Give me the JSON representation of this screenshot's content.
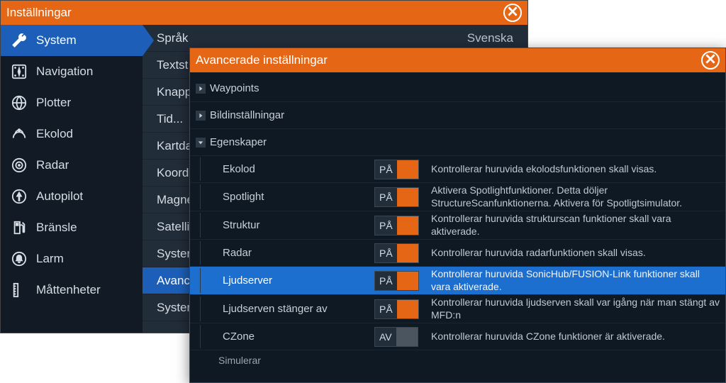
{
  "win1": {
    "title": "Inställningar",
    "sidebar": [
      {
        "id": "system",
        "label": "System",
        "icon": "wrench",
        "selected": true
      },
      {
        "id": "navigation",
        "label": "Navigation",
        "icon": "compass-square"
      },
      {
        "id": "plotter",
        "label": "Plotter",
        "icon": "globe"
      },
      {
        "id": "ekolod",
        "label": "Ekolod",
        "icon": "sonar"
      },
      {
        "id": "radar",
        "label": "Radar",
        "icon": "target"
      },
      {
        "id": "autopilot",
        "label": "Autopilot",
        "icon": "arrow-circle"
      },
      {
        "id": "bransle",
        "label": "Bränsle",
        "icon": "fuel"
      },
      {
        "id": "larm",
        "label": "Larm",
        "icon": "bell"
      },
      {
        "id": "matten",
        "label": "Måttenheter",
        "icon": "ruler"
      }
    ],
    "rows": [
      {
        "label": "Språk",
        "value": "Svenska"
      },
      {
        "label": "Textst"
      },
      {
        "label": "Knapp"
      },
      {
        "label": "Tid..."
      },
      {
        "label": "Kartda"
      },
      {
        "label": "Koord"
      },
      {
        "label": "Magne"
      },
      {
        "label": "Satelli"
      },
      {
        "label": "Syster"
      },
      {
        "label": "Avanc",
        "selected": true
      },
      {
        "label": "Syster"
      }
    ]
  },
  "win2": {
    "title": "Avancerade inställningar",
    "groups": [
      {
        "label": "Waypoints",
        "expanded": false
      },
      {
        "label": "Bildinställningar",
        "expanded": false
      },
      {
        "label": "Egenskaper",
        "expanded": true
      }
    ],
    "features": [
      {
        "label": "Ekolod",
        "state": "PÅ",
        "on": true,
        "desc": "Kontrollerar huruvida ekolodsfunktionen skall visas."
      },
      {
        "label": "Spotlight",
        "state": "PÅ",
        "on": true,
        "desc": "Aktivera Spotlightfunktioner. Detta döljer StructureScanfunktionerna. Aktivera för Spotligtsimulator."
      },
      {
        "label": "Struktur",
        "state": "PÅ",
        "on": true,
        "desc": "Kontrollerar huruvida strukturscan funktioner skall vara aktiverade."
      },
      {
        "label": "Radar",
        "state": "PÅ",
        "on": true,
        "desc": "Kontrollerar huruvida radarfunktionen skall visas."
      },
      {
        "label": "Ljudserver",
        "state": "PÅ",
        "on": true,
        "selected": true,
        "desc": "Kontrollerar huruvida SonicHub/FUSION-Link funktioner skall vara aktiverade."
      },
      {
        "label": "Ljudserven stänger av",
        "state": "PÅ",
        "on": true,
        "desc": "Kontrollerar huruvida ljudserven skall var igång när man stängt av MFD:n"
      },
      {
        "label": "CZone",
        "state": "AV",
        "on": false,
        "desc": "Kontrollerar huruvida CZone funktioner är aktiverade."
      }
    ],
    "footer": "Simulerar"
  }
}
